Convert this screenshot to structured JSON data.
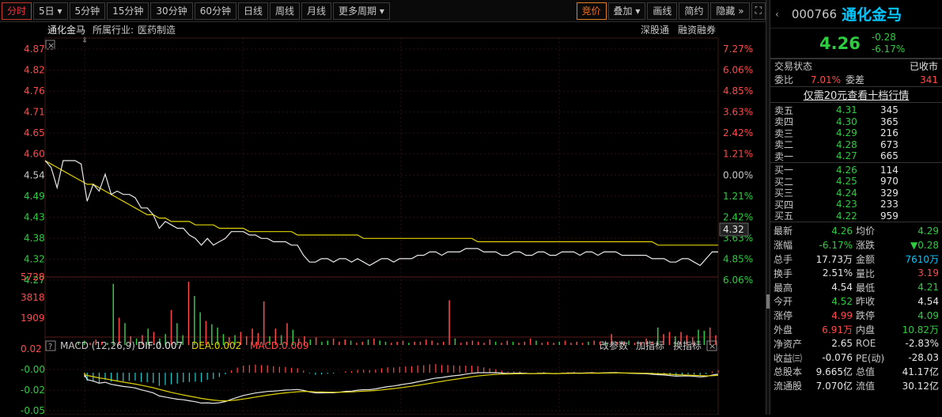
{
  "toolbar": {
    "tabs": [
      "分时",
      "5日",
      "5分钟",
      "15分钟",
      "30分钟",
      "60分钟",
      "日线",
      "周线",
      "月线",
      "更多周期"
    ],
    "right_buttons": [
      "竞价",
      "叠加",
      "画线",
      "简约",
      "隐藏"
    ]
  },
  "chart_header": {
    "stock": "通化金马",
    "industry_label": "所属行业:",
    "industry": "医药制造",
    "tag1": "深股通",
    "tag2": "融资融券"
  },
  "macd_header": {
    "label": "MACD (12,26,9)",
    "dif": "DIF:0.007",
    "dea": "DEA:0.002",
    "macd": "MACD:0.009",
    "btn1": "改参数",
    "btn2": "加指标",
    "btn3": "换指标"
  },
  "current_price_tag": "4.32",
  "chart_data": {
    "type": "line",
    "price_axis_left": [
      "4.87",
      "4.82",
      "4.76",
      "4.71",
      "4.65",
      "4.60",
      "4.54",
      "4.49",
      "4.43",
      "4.38",
      "4.32",
      "4.27"
    ],
    "pct_axis_right": [
      "7.27%",
      "6.06%",
      "4.85%",
      "3.63%",
      "2.42%",
      "1.21%",
      "0.00%",
      "1.21%",
      "2.42%",
      "3.63%",
      "4.85%",
      "6.06%"
    ],
    "volume_axis": [
      "5728",
      "3818",
      "1909"
    ],
    "macd_axis": [
      "0.02",
      "-0.00",
      "-0.02",
      "-0.05"
    ],
    "price_range": [
      4.21,
      4.87
    ],
    "prev_close": 4.54,
    "price_series": [
      4.54,
      4.52,
      4.46,
      4.54,
      4.54,
      4.54,
      4.53,
      4.42,
      4.47,
      4.45,
      4.5,
      4.44,
      4.45,
      4.44,
      4.44,
      4.43,
      4.4,
      4.4,
      4.38,
      4.34,
      4.36,
      4.35,
      4.34,
      4.34,
      4.32,
      4.31,
      4.29,
      4.31,
      4.29,
      4.3,
      4.31,
      4.33,
      4.33,
      4.33,
      4.32,
      4.32,
      4.31,
      4.31,
      4.3,
      4.3,
      4.3,
      4.29,
      4.29,
      4.26,
      4.24,
      4.24,
      4.25,
      4.25,
      4.24,
      4.25,
      4.25,
      4.24,
      4.25,
      4.24,
      4.23,
      4.24,
      4.25,
      4.25,
      4.24,
      4.25,
      4.25,
      4.25,
      4.26,
      4.26,
      4.27,
      4.27,
      4.26,
      4.27,
      4.27,
      4.27,
      4.28,
      4.28,
      4.28,
      4.27,
      4.27,
      4.27,
      4.26,
      4.26,
      4.27,
      4.27,
      4.26,
      4.26,
      4.27,
      4.27,
      4.26,
      4.26,
      4.27,
      4.27,
      4.27,
      4.26,
      4.27,
      4.27,
      4.26,
      4.27,
      4.27,
      4.27,
      4.26,
      4.26,
      4.26,
      4.26,
      4.26,
      4.25,
      4.25,
      4.25,
      4.24,
      4.24,
      4.25,
      4.25,
      4.24,
      4.23,
      4.25,
      4.27,
      4.27
    ],
    "avg_series": [
      4.54,
      4.53,
      4.52,
      4.51,
      4.5,
      4.49,
      4.48,
      4.47,
      4.47,
      4.46,
      4.45,
      4.44,
      4.43,
      4.42,
      4.41,
      4.4,
      4.39,
      4.38,
      4.38,
      4.37,
      4.37,
      4.36,
      4.36,
      4.36,
      4.36,
      4.35,
      4.35,
      4.35,
      4.35,
      4.34,
      4.34,
      4.34,
      4.34,
      4.34,
      4.33,
      4.33,
      4.33,
      4.33,
      4.33,
      4.33,
      4.33,
      4.33,
      4.32,
      4.32,
      4.32,
      4.32,
      4.32,
      4.32,
      4.32,
      4.32,
      4.32,
      4.32,
      4.32,
      4.31,
      4.31,
      4.31,
      4.31,
      4.31,
      4.31,
      4.31,
      4.31,
      4.31,
      4.31,
      4.31,
      4.31,
      4.31,
      4.31,
      4.31,
      4.31,
      4.31,
      4.31,
      4.31,
      4.3,
      4.3,
      4.3,
      4.3,
      4.3,
      4.3,
      4.3,
      4.3,
      4.3,
      4.3,
      4.3,
      4.3,
      4.3,
      4.3,
      4.3,
      4.3,
      4.3,
      4.3,
      4.3,
      4.3,
      4.3,
      4.3,
      4.3,
      4.3,
      4.3,
      4.3,
      4.3,
      4.3,
      4.3,
      4.3,
      4.29,
      4.29,
      4.29,
      4.29,
      4.29,
      4.29,
      4.29,
      4.29,
      4.29,
      4.29,
      4.29
    ],
    "volume_series": [
      100,
      300,
      400,
      200,
      500,
      300,
      200,
      5600,
      2500,
      2000,
      800,
      600,
      900,
      1500,
      1200,
      600,
      1000,
      3200,
      2000,
      900,
      5800,
      4500,
      3000,
      2200,
      1900,
      1600,
      1000,
      700,
      900,
      1200,
      800,
      1500,
      1100,
      4000,
      800,
      1500,
      900,
      2000,
      1400,
      600,
      800,
      500,
      700,
      300,
      400,
      600,
      300,
      500,
      400,
      200,
      300,
      500,
      600,
      400,
      300,
      200,
      300,
      400,
      200,
      300,
      300,
      500,
      400,
      200,
      300,
      4100,
      600,
      200,
      300,
      400,
      300,
      200,
      500,
      300,
      200,
      400,
      300,
      200,
      300,
      600,
      400,
      200,
      300,
      200,
      300,
      400,
      200,
      300,
      200,
      300,
      400,
      300,
      200,
      1000,
      300,
      300,
      400,
      200,
      300,
      600,
      300,
      1600,
      1000,
      1200,
      800,
      1200,
      900,
      700,
      1400,
      1300,
      1600,
      900
    ]
  },
  "panel": {
    "code": "000766",
    "name": "通化金马",
    "price": "4.26",
    "change": "-0.28",
    "change_pct": "-6.17%",
    "trade_status_label": "交易状态",
    "trade_status": "已收市",
    "wb_label": "委比",
    "wb_value": "7.01%",
    "wc_label": "委差",
    "wc_value": "341",
    "promo": "仅需20元查看十档行情",
    "asks": [
      {
        "label": "卖五",
        "price": "4.31",
        "vol": "345"
      },
      {
        "label": "卖四",
        "price": "4.30",
        "vol": "365"
      },
      {
        "label": "卖三",
        "price": "4.29",
        "vol": "216"
      },
      {
        "label": "卖二",
        "price": "4.28",
        "vol": "673"
      },
      {
        "label": "卖一",
        "price": "4.27",
        "vol": "665"
      }
    ],
    "bids": [
      {
        "label": "买一",
        "price": "4.26",
        "vol": "114"
      },
      {
        "label": "买二",
        "price": "4.25",
        "vol": "970"
      },
      {
        "label": "买三",
        "price": "4.24",
        "vol": "329"
      },
      {
        "label": "买四",
        "price": "4.23",
        "vol": "233"
      },
      {
        "label": "买五",
        "price": "4.22",
        "vol": "959"
      }
    ],
    "stats": [
      {
        "k1": "最新",
        "v1": "4.26",
        "c1": "green",
        "k2": "均价",
        "v2": "4.29",
        "c2": "green"
      },
      {
        "k1": "涨幅",
        "v1": "-6.17%",
        "c1": "green",
        "k2": "涨跌",
        "v2": "▼0.28",
        "c2": "green"
      },
      {
        "k1": "总手",
        "v1": "17.73万",
        "c1": "white",
        "k2": "金额",
        "v2": "7610万",
        "c2": "blue"
      },
      {
        "k1": "换手",
        "v1": "2.51%",
        "c1": "white",
        "k2": "量比",
        "v2": "3.19",
        "c2": "red"
      },
      {
        "k1": "最高",
        "v1": "4.54",
        "c1": "white",
        "k2": "最低",
        "v2": "4.21",
        "c2": "green"
      },
      {
        "k1": "今开",
        "v1": "4.52",
        "c1": "green",
        "k2": "昨收",
        "v2": "4.54",
        "c2": "white"
      },
      {
        "k1": "涨停",
        "v1": "4.99",
        "c1": "red",
        "k2": "跌停",
        "v2": "4.09",
        "c2": "green"
      },
      {
        "k1": "外盘",
        "v1": "6.91万",
        "c1": "red",
        "k2": "内盘",
        "v2": "10.82万",
        "c2": "green"
      },
      {
        "k1": "净资产",
        "v1": "2.65",
        "c1": "white",
        "k2": "ROE",
        "v2": "-2.83%",
        "c2": "white"
      },
      {
        "k1": "收益㈢",
        "v1": "-0.076",
        "c1": "white",
        "k2": "PE(动)",
        "v2": "-28.03",
        "c2": "white"
      },
      {
        "k1": "总股本",
        "v1": "9.665亿",
        "c1": "white",
        "k2": "总值",
        "v2": "41.17亿",
        "c2": "white"
      },
      {
        "k1": "流通股",
        "v1": "7.070亿",
        "c1": "white",
        "k2": "流值",
        "v2": "30.12亿",
        "c2": "white"
      }
    ]
  }
}
